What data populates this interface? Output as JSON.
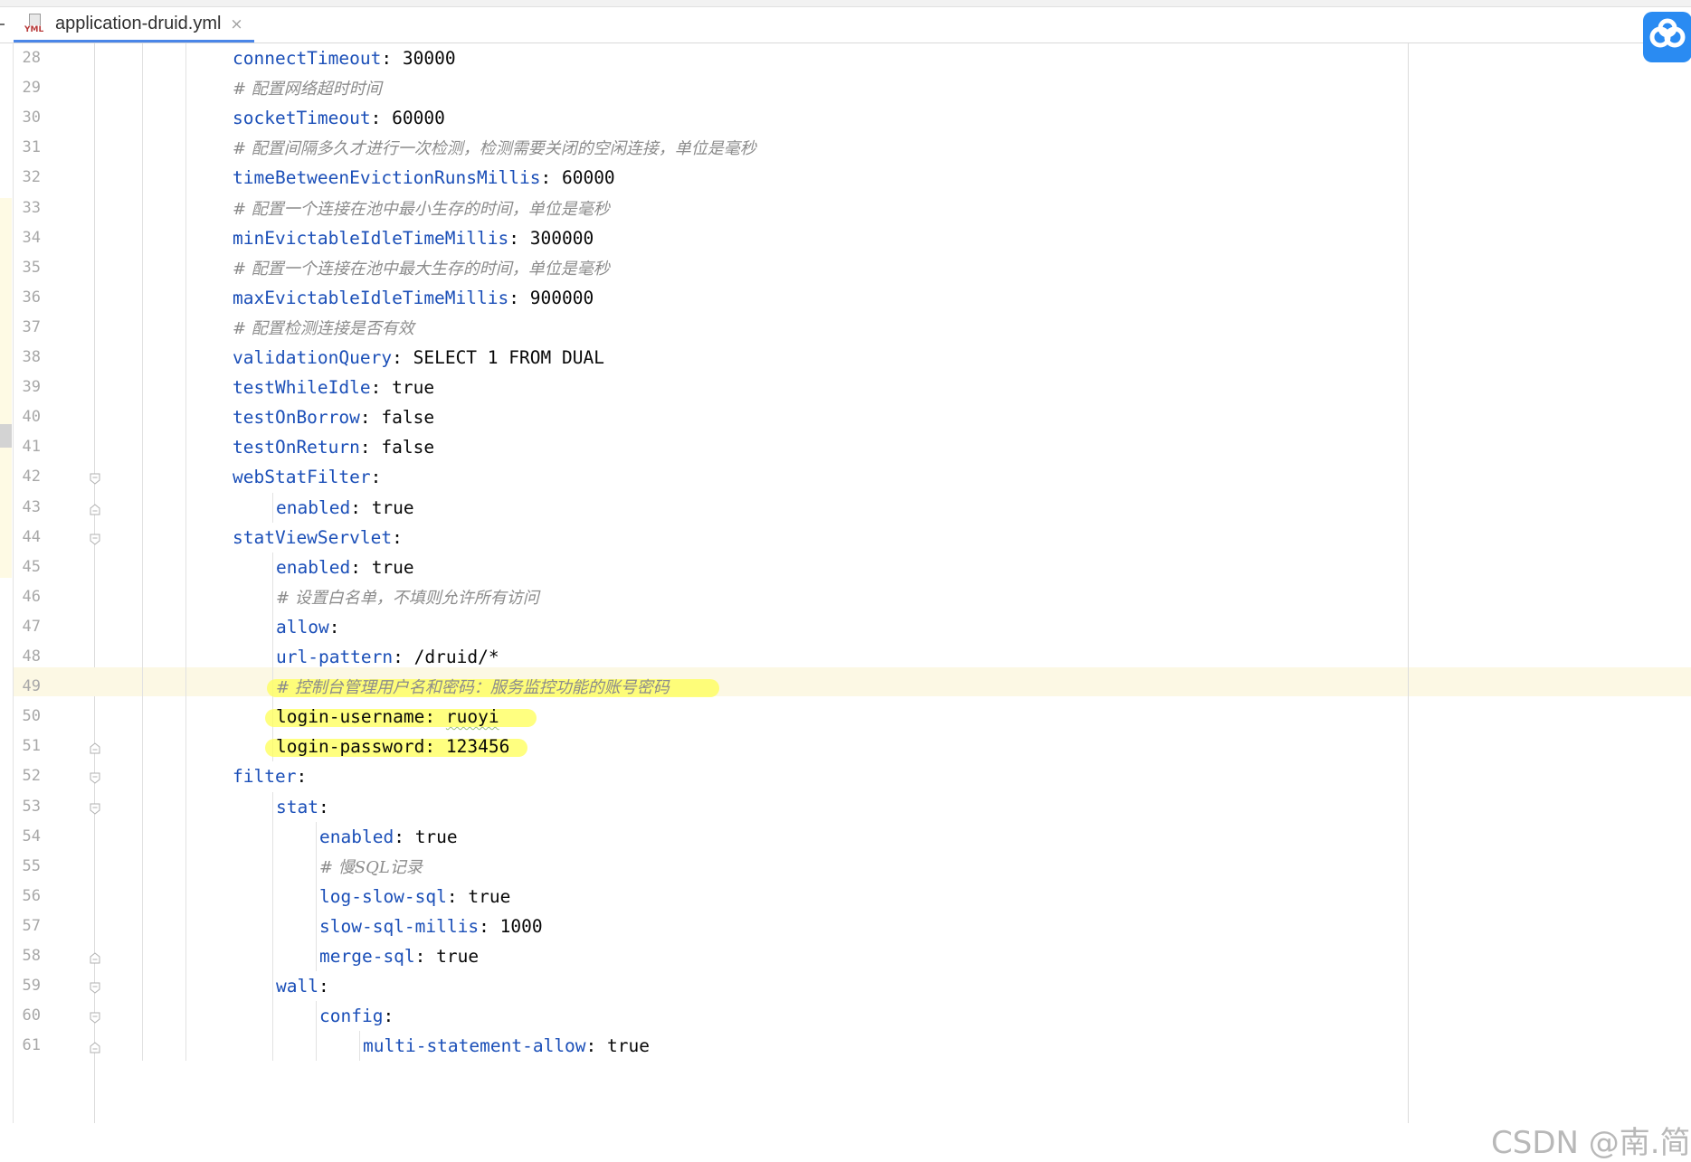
{
  "tab": {
    "title": "application-druid.yml",
    "icon_label": "YML",
    "close": "×"
  },
  "lines": [
    {
      "num": "28",
      "indent": 1,
      "key": "connectTimeout",
      "value": "30000"
    },
    {
      "num": "29",
      "indent": 1,
      "comment": "# 配置网络超时时间"
    },
    {
      "num": "30",
      "indent": 1,
      "key": "socketTimeout",
      "value": "60000"
    },
    {
      "num": "31",
      "indent": 1,
      "comment": "# 配置间隔多久才进行一次检测，检测需要关闭的空闲连接，单位是毫秒"
    },
    {
      "num": "32",
      "indent": 1,
      "key": "timeBetweenEvictionRunsMillis",
      "value": "60000"
    },
    {
      "num": "33",
      "indent": 1,
      "comment": "# 配置一个连接在池中最小生存的时间，单位是毫秒"
    },
    {
      "num": "34",
      "indent": 1,
      "key": "minEvictableIdleTimeMillis",
      "value": "300000"
    },
    {
      "num": "35",
      "indent": 1,
      "comment": "# 配置一个连接在池中最大生存的时间，单位是毫秒"
    },
    {
      "num": "36",
      "indent": 1,
      "key": "maxEvictableIdleTimeMillis",
      "value": "900000"
    },
    {
      "num": "37",
      "indent": 1,
      "comment": "# 配置检测连接是否有效"
    },
    {
      "num": "38",
      "indent": 1,
      "key": "validationQuery",
      "value": "SELECT 1 FROM DUAL"
    },
    {
      "num": "39",
      "indent": 1,
      "key": "testWhileIdle",
      "value": "true"
    },
    {
      "num": "40",
      "indent": 1,
      "key": "testOnBorrow",
      "value": "false"
    },
    {
      "num": "41",
      "indent": 1,
      "key": "testOnReturn",
      "value": "false"
    },
    {
      "num": "42",
      "indent": 1,
      "key": "webStatFilter",
      "value": "",
      "fold": "open"
    },
    {
      "num": "43",
      "indent": 2,
      "key": "enabled",
      "value": "true",
      "fold": "close"
    },
    {
      "num": "44",
      "indent": 1,
      "key": "statViewServlet",
      "value": "",
      "fold": "open"
    },
    {
      "num": "45",
      "indent": 2,
      "key": "enabled",
      "value": "true"
    },
    {
      "num": "46",
      "indent": 2,
      "comment": "# 设置白名单，不填则允许所有访问"
    },
    {
      "num": "47",
      "indent": 2,
      "key": "allow",
      "value": ""
    },
    {
      "num": "48",
      "indent": 2,
      "key": "url-pattern",
      "value": "/druid/*"
    },
    {
      "num": "49",
      "indent": 2,
      "comment": "# 控制台管理用户名和密码：服务监控功能的账号密码",
      "current": true
    },
    {
      "num": "50",
      "indent": 2,
      "key": "login-username",
      "value": "ruoyi",
      "plain": true
    },
    {
      "num": "51",
      "indent": 2,
      "key": "login-password",
      "value": "123456",
      "plain": true,
      "fold": "close"
    },
    {
      "num": "52",
      "indent": 1,
      "key": "filter",
      "value": "",
      "fold": "open"
    },
    {
      "num": "53",
      "indent": 2,
      "key": "stat",
      "value": "",
      "fold": "open"
    },
    {
      "num": "54",
      "indent": 3,
      "key": "enabled",
      "value": "true"
    },
    {
      "num": "55",
      "indent": 3,
      "comment": "# 慢SQL记录"
    },
    {
      "num": "56",
      "indent": 3,
      "key": "log-slow-sql",
      "value": "true"
    },
    {
      "num": "57",
      "indent": 3,
      "key": "slow-sql-millis",
      "value": "1000"
    },
    {
      "num": "58",
      "indent": 3,
      "key": "merge-sql",
      "value": "true",
      "fold": "close"
    },
    {
      "num": "59",
      "indent": 2,
      "key": "wall",
      "value": "",
      "fold": "open"
    },
    {
      "num": "60",
      "indent": 3,
      "key": "config",
      "value": "",
      "fold": "open"
    },
    {
      "num": "61",
      "indent": 4,
      "key": "multi-statement-allow",
      "value": "true",
      "fold": "close"
    }
  ],
  "watermark": "CSDN @南.简",
  "colors": {
    "key": "#1b4fb8",
    "comment": "#8c8c8c",
    "value": "#080808",
    "highlight": "#ffff55",
    "tab_accent": "#4a86e8"
  }
}
